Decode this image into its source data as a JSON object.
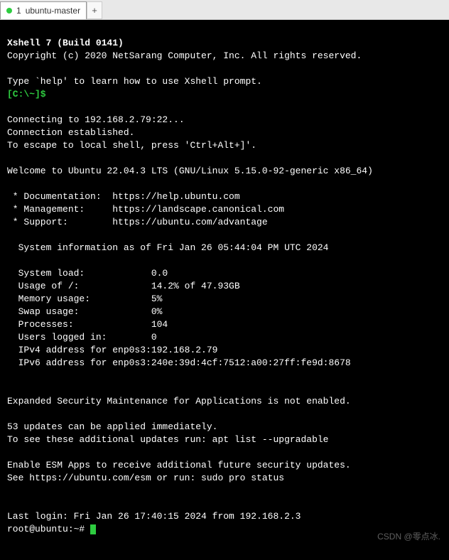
{
  "tab": {
    "index": "1",
    "title": "ubuntu-master",
    "new_tab_label": "+"
  },
  "header": {
    "title": "Xshell 7 (Build 0141)",
    "copyright": "Copyright (c) 2020 NetSarang Computer, Inc. All rights reserved.",
    "help_line": "Type `help' to learn how to use Xshell prompt.",
    "prompt": "[C:\\~]$"
  },
  "connection": {
    "connecting": "Connecting to 192.168.2.79:22...",
    "established": "Connection established.",
    "escape": "To escape to local shell, press 'Ctrl+Alt+]'."
  },
  "welcome": "Welcome to Ubuntu 22.04.3 LTS (GNU/Linux 5.15.0-92-generic x86_64)",
  "links": {
    "doc_label": " * Documentation:  https://help.ubuntu.com",
    "mgmt_label": " * Management:     https://landscape.canonical.com",
    "support_label": " * Support:        https://ubuntu.com/advantage"
  },
  "sysinfo": {
    "asof": "  System information as of Fri Jan 26 05:44:04 PM UTC 2024",
    "rows": [
      {
        "label": "  System load:",
        "value": "0.0"
      },
      {
        "label": "  Usage of /:",
        "value": "14.2% of 47.93GB"
      },
      {
        "label": "  Memory usage:",
        "value": "5%"
      },
      {
        "label": "  Swap usage:",
        "value": "0%"
      },
      {
        "label": "  Processes:",
        "value": "104"
      },
      {
        "label": "  Users logged in:",
        "value": "0"
      },
      {
        "label": "  IPv4 address for enp0s3:",
        "value": "192.168.2.79"
      },
      {
        "label": "  IPv6 address for enp0s3:",
        "value": "240e:39d:4cf:7512:a00:27ff:fe9d:8678"
      }
    ]
  },
  "security": {
    "esm": "Expanded Security Maintenance for Applications is not enabled.",
    "updates": "53 updates can be applied immediately.",
    "see_updates": "To see these additional updates run: apt list --upgradable",
    "enable_esm": "Enable ESM Apps to receive additional future security updates.",
    "see_esm": "See https://ubuntu.com/esm or run: sudo pro status"
  },
  "footer": {
    "last_login": "Last login: Fri Jan 26 17:40:15 2024 from 192.168.2.3",
    "shell_prompt": "root@ubuntu:~# "
  },
  "watermark": "CSDN @零点冰."
}
